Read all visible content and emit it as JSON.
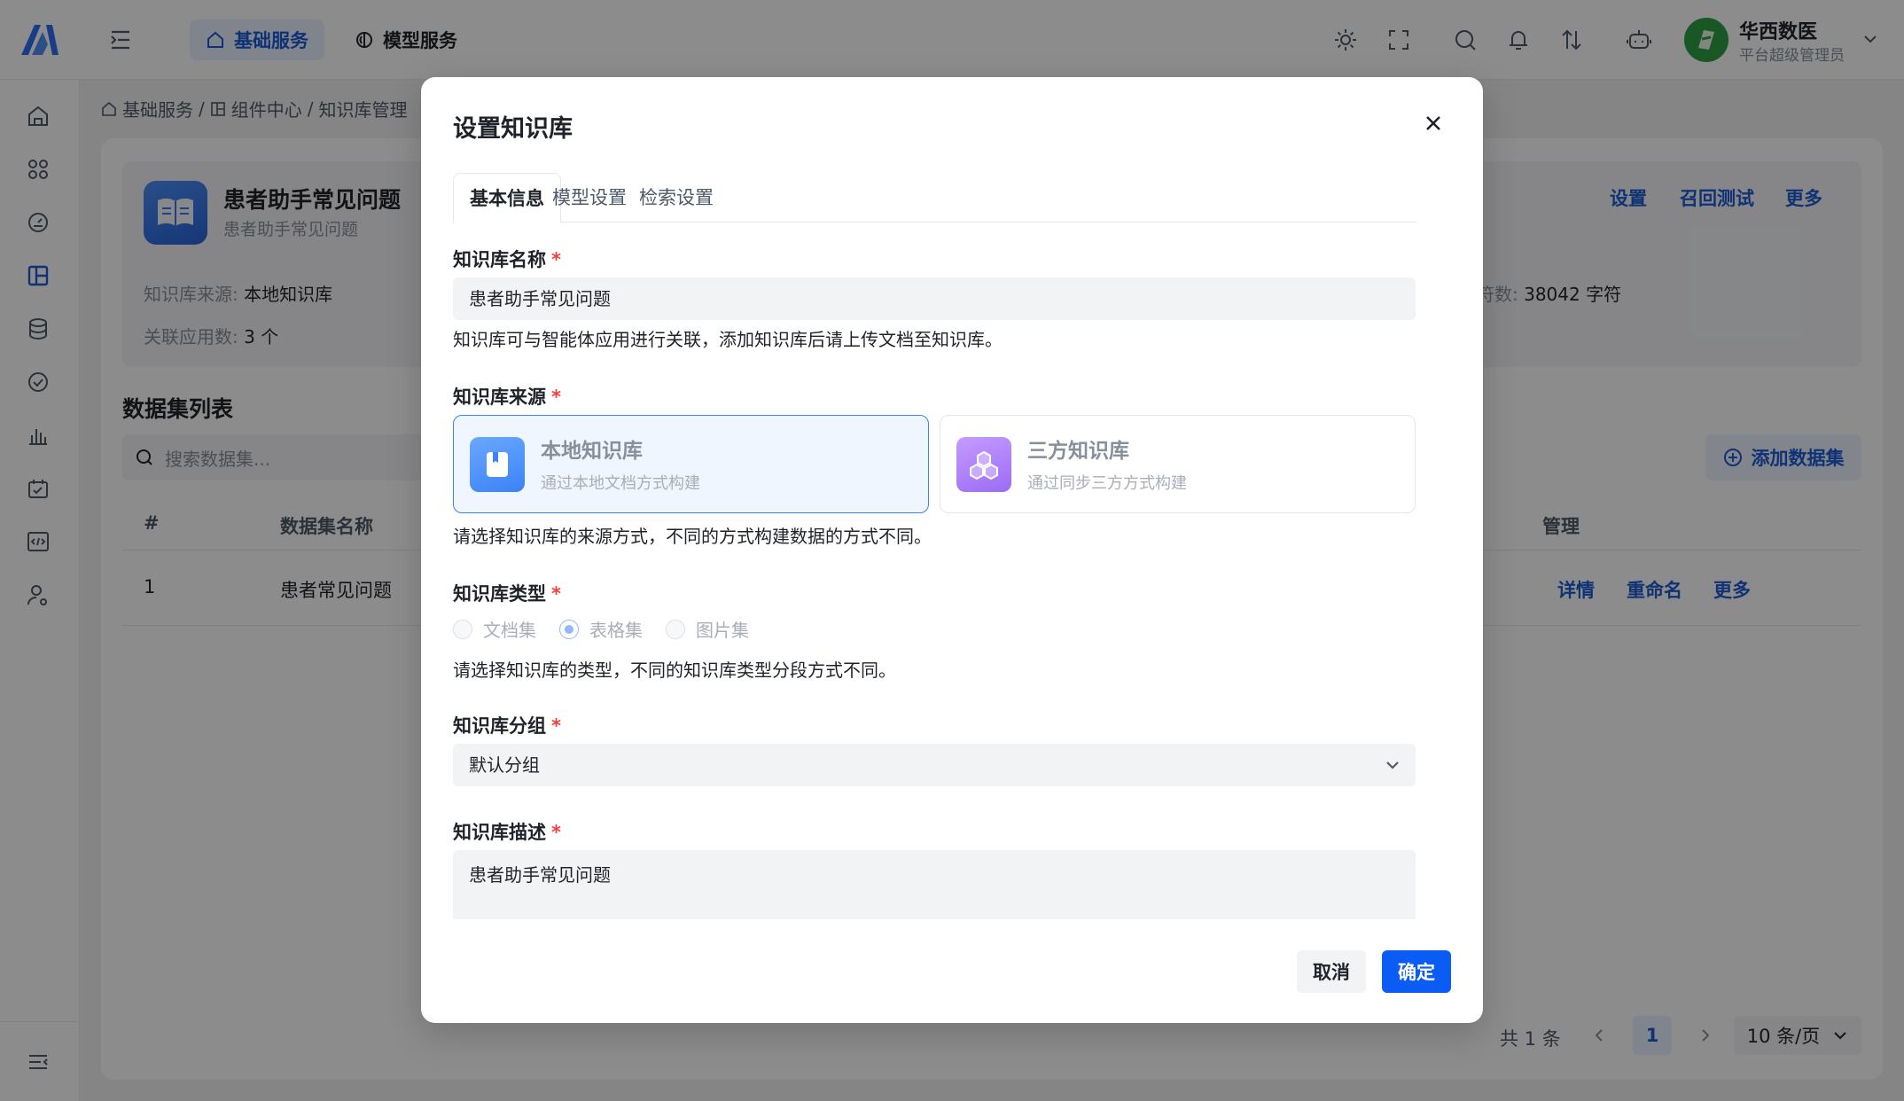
{
  "topbar": {
    "tabs": [
      {
        "label": "基础服务",
        "icon": "home-icon",
        "active": true
      },
      {
        "label": "模型服务",
        "icon": "model-icon",
        "active": false
      }
    ],
    "user": {
      "name": "华西数医",
      "role": "平台超级管理员"
    }
  },
  "breadcrumb": {
    "items": [
      "基础服务",
      "组件中心",
      "知识库管理"
    ],
    "separator": "/"
  },
  "kb_card": {
    "title": "患者助手常见问题",
    "subtitle": "患者助手常见问题",
    "source_label": "知识库来源:",
    "source_value": "本地知识库",
    "apps_label": "关联应用数:",
    "apps_value": "3 个",
    "chars_label": "符数:",
    "chars_value": "38042 字符",
    "actions": [
      "设置",
      "召回测试",
      "更多"
    ]
  },
  "dataset": {
    "section_title": "数据集列表",
    "search_placeholder": "搜索数据集...",
    "add_label": "添加数据集",
    "columns": {
      "index": "#",
      "name": "数据集名称",
      "manage": "管理"
    },
    "rows": [
      {
        "index": "1",
        "name": "患者常见问题",
        "actions": [
          "详情",
          "重命名",
          "更多"
        ]
      }
    ],
    "pagination": {
      "total": "共 1 条",
      "current": "1",
      "page_size": "10 条/页"
    }
  },
  "modal": {
    "title": "设置知识库",
    "tabs": [
      "基本信息",
      "模型设置",
      "检索设置"
    ],
    "active_tab": 0,
    "name_field": {
      "label": "知识库名称",
      "value": "患者助手常见问题",
      "help": "知识库可与智能体应用进行关联，添加知识库后请上传文档至知识库。"
    },
    "source_field": {
      "label": "知识库来源",
      "options": [
        {
          "title": "本地知识库",
          "desc": "通过本地文档方式构建",
          "selected": true
        },
        {
          "title": "三方知识库",
          "desc": "通过同步三方方式构建",
          "selected": false
        }
      ],
      "help": "请选择知识库的来源方式，不同的方式构建数据的方式不同。"
    },
    "type_field": {
      "label": "知识库类型",
      "options": [
        "文档集",
        "表格集",
        "图片集"
      ],
      "selected": 1,
      "help": "请选择知识库的类型，不同的知识库类型分段方式不同。"
    },
    "group_field": {
      "label": "知识库分组",
      "value": "默认分组"
    },
    "desc_field": {
      "label": "知识库描述",
      "value": "患者助手常见问题"
    },
    "required_mark": "*",
    "cancel_label": "取消",
    "ok_label": "确定"
  },
  "colors": {
    "primary": "#0a5cf5",
    "link": "#1d5bd6",
    "required": "#f53f3f",
    "selected_border": "#3b82f6"
  }
}
